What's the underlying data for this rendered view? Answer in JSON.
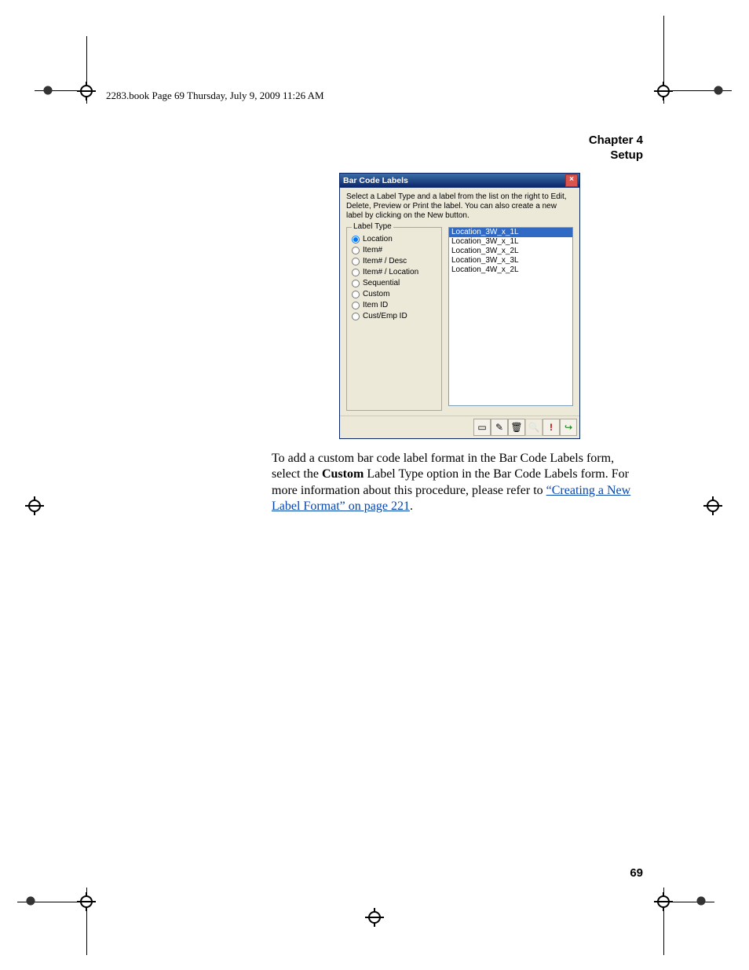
{
  "running_head": "2283.book  Page 69  Thursday, July 9, 2009  11:26 AM",
  "chapter": {
    "line1": "Chapter 4",
    "line2": "Setup"
  },
  "dialog": {
    "title": "Bar Code Labels",
    "description": "Select a Label Type and a label from the list on the right to Edit, Delete, Preview or Print the label. You can also create a new label by clicking on the New button.",
    "group_legend": "Label Type",
    "radios": [
      {
        "label": "Location",
        "checked": true
      },
      {
        "label": "Item#",
        "checked": false
      },
      {
        "label": "Item# / Desc",
        "checked": false
      },
      {
        "label": "Item# / Location",
        "checked": false
      },
      {
        "label": "Sequential",
        "checked": false
      },
      {
        "label": "Custom",
        "checked": false
      },
      {
        "label": "Item ID",
        "checked": false
      },
      {
        "label": "Cust/Emp ID",
        "checked": false
      }
    ],
    "list": [
      {
        "label": "Location_3W_x_1L",
        "selected": true
      },
      {
        "label": "Location_3W_x_1L",
        "selected": false
      },
      {
        "label": "Location_3W_x_2L",
        "selected": false
      },
      {
        "label": "Location_3W_x_3L",
        "selected": false
      },
      {
        "label": "Location_4W_x_2L",
        "selected": false
      }
    ],
    "buttons": {
      "new": {
        "glyph": "▭",
        "name": "new-button",
        "enabled": true
      },
      "edit": {
        "glyph": "✎",
        "name": "edit-button",
        "enabled": true
      },
      "delete": {
        "glyph": "🗑",
        "name": "delete-button",
        "enabled": true
      },
      "preview": {
        "glyph": "🔍",
        "name": "preview-button",
        "enabled": false
      },
      "print": {
        "glyph": "!",
        "name": "print-button",
        "enabled": true
      },
      "exit": {
        "glyph": "↪",
        "name": "exit-button",
        "enabled": true
      }
    }
  },
  "body_text": {
    "pre": "To add a custom bar code label format in the Bar Code Labels form, select the ",
    "bold": "Custom",
    "mid": " Label Type option in the Bar Code Labels form. For more information about this procedure, please refer to ",
    "link": "“Creating a New Label Format” on page 221",
    "post": "."
  },
  "page_number": "69"
}
